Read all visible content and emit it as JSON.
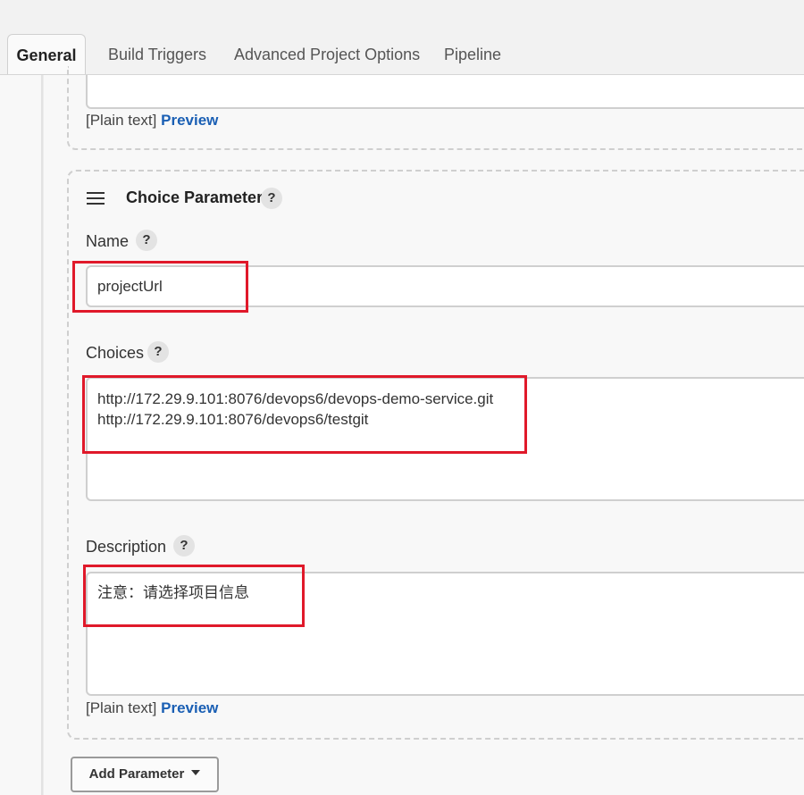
{
  "tabs": [
    {
      "label": "General",
      "active": true
    },
    {
      "label": "Build Triggers",
      "active": false
    },
    {
      "label": "Advanced Project Options",
      "active": false
    },
    {
      "label": "Pipeline",
      "active": false
    }
  ],
  "previous_parameter": {
    "plain_text": "[Plain text]",
    "preview_label": "Preview"
  },
  "choice_parameter": {
    "title": "Choice Parameter",
    "help_glyph": "?",
    "name_label": "Name",
    "name_value": "projectUrl",
    "choices_label": "Choices",
    "choices_value": "http://172.29.9.101:8076/devops6/devops-demo-service.git\nhttp://172.29.9.101:8076/devops6/testgit",
    "description_label": "Description",
    "description_value": "注意：请选择项目信息",
    "plain_text": "[Plain text]",
    "preview_label": "Preview"
  },
  "add_parameter_label": "Add Parameter",
  "colors": {
    "highlight": "#e0192a",
    "link": "#1a5fb4"
  }
}
